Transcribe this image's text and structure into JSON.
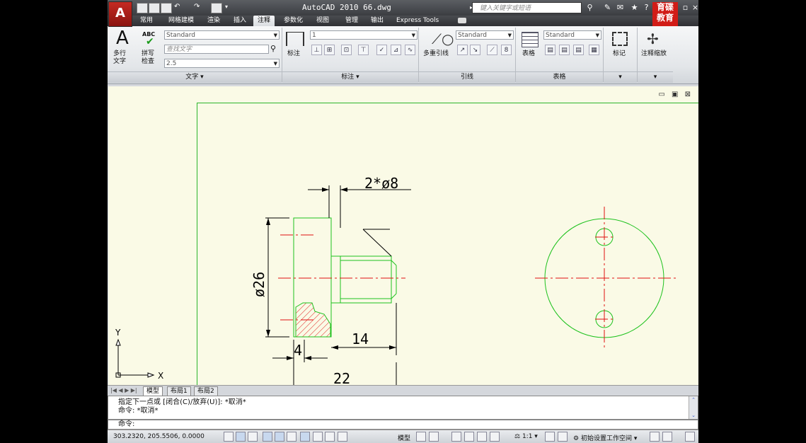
{
  "window": {
    "title": "AutoCAD 2010   66.dwg",
    "search_placeholder": "键入关键字或短语",
    "app_button": "A",
    "logo_text": "育碟\n教育"
  },
  "tabs": [
    {
      "label": "常用",
      "active": false
    },
    {
      "label": "网格建模",
      "active": false
    },
    {
      "label": "渲染",
      "active": false
    },
    {
      "label": "插入",
      "active": false
    },
    {
      "label": "注释",
      "active": true
    },
    {
      "label": "参数化",
      "active": false
    },
    {
      "label": "视图",
      "active": false
    },
    {
      "label": "管理",
      "active": false
    },
    {
      "label": "输出",
      "active": false
    },
    {
      "label": "Express Tools",
      "active": false
    }
  ],
  "ribbon": {
    "text_panel": {
      "mtext_label": "多行\n文字",
      "spell_label": "拼写\n检查",
      "abc_label": "ABC",
      "style_value": "Standard",
      "find_placeholder": "查找文字",
      "height_value": "2.5",
      "footer": "文字"
    },
    "dim_panel": {
      "dim_label": "标注",
      "scale_value": "1",
      "footer": "标注"
    },
    "leader_panel": {
      "mleader_label": "多重引线",
      "style_value": "Standard",
      "footer": "引线"
    },
    "table_panel": {
      "table_label": "表格",
      "style_value": "Standard",
      "footer": "表格"
    },
    "markup_panel": {
      "label": "标记"
    },
    "scale_panel": {
      "label": "注释缩放"
    }
  },
  "drawing": {
    "dim_holes": "2*ø8",
    "dim_diameter": "ø26",
    "dim_4": "4",
    "dim_14": "14",
    "dim_22": "22",
    "ucs_x": "X",
    "ucs_y": "Y"
  },
  "layout_tabs": [
    "模型",
    "布局1",
    "布局2"
  ],
  "command": {
    "history": [
      "指定下一点或 [闭合(C)/放弃(U)]: *取消*",
      "命令: *取消*"
    ],
    "prompt": "命令:"
  },
  "status": {
    "coordinates": "303.2320, 205.5506, 0.0000",
    "model_label": "模型",
    "scale": "1:1",
    "workspace": "初始设置工作空间"
  },
  "colors": {
    "accent": "#c52a22",
    "drawing_bg": "#fafae6",
    "geometry_green": "#1ec21e",
    "centerline_red": "#e01010"
  }
}
